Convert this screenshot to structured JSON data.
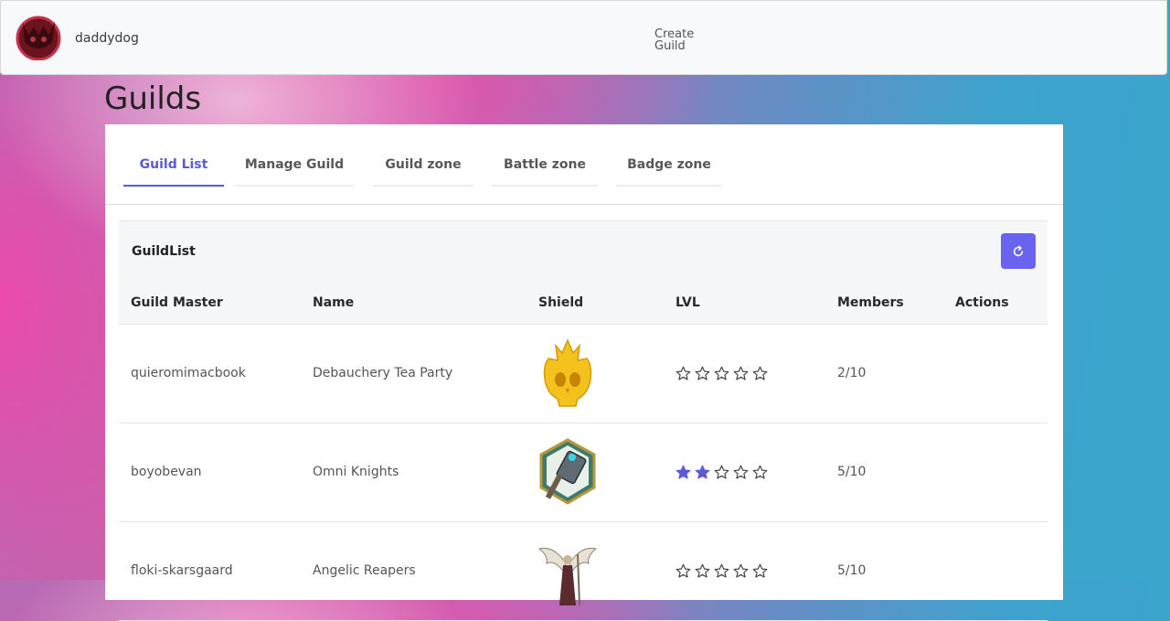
{
  "header": {
    "username": "daddydog",
    "create_guild": "Create\nGuild"
  },
  "page": {
    "title": "Guilds"
  },
  "tabs": [
    {
      "label": "Guild List",
      "active": true
    },
    {
      "label": "Manage Guild",
      "active": false
    },
    {
      "label": "Guild zone",
      "active": false
    },
    {
      "label": "Battle zone",
      "active": false
    },
    {
      "label": "Badge zone",
      "active": false
    }
  ],
  "panel": {
    "title": "GuildList",
    "refresh_icon": "refresh-icon"
  },
  "table": {
    "columns": [
      "Guild Master",
      "Name",
      "Shield",
      "LVL",
      "Members",
      "Actions"
    ],
    "rows": [
      {
        "master": "quieromimacbook",
        "name": "Debauchery Tea Party",
        "shield": "golden-skull-shield",
        "level": 0,
        "max_level": 5,
        "members": "2/10"
      },
      {
        "master": "boyobevan",
        "name": "Omni Knights",
        "shield": "hammer-hexagon-shield",
        "level": 2,
        "max_level": 5,
        "members": "5/10"
      },
      {
        "master": "floki-skarsgaard",
        "name": "Angelic Reapers",
        "shield": "winged-reaper-shield",
        "level": 0,
        "max_level": 5,
        "members": "5/10"
      }
    ]
  },
  "colors": {
    "accent": "#5b5bd6",
    "button": "#6a63f0"
  }
}
